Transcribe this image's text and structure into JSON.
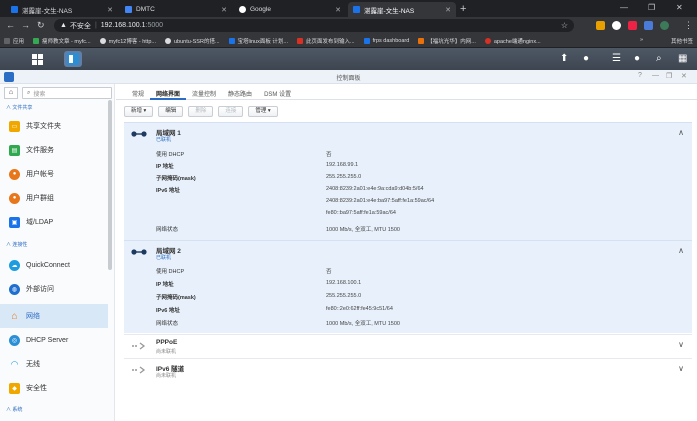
{
  "browser": {
    "tabs": [
      {
        "title": "湛露崖-文生-NAS",
        "color": "#1a73e8"
      },
      {
        "title": "DMTC",
        "color": "#4285f4"
      },
      {
        "title": "Google",
        "color": "#ffffff"
      },
      {
        "title": "湛露崖-文生-NAS",
        "color": "#1a73e8"
      }
    ],
    "new_tab": "+",
    "address": {
      "security": "不安全",
      "host": "192.168.100.1",
      "port": ":5000"
    },
    "bookmarks": [
      {
        "label": "应用",
        "color": "#5f6368"
      },
      {
        "label": "瘦师教文章 - myfc...",
        "color": "#34a853"
      },
      {
        "label": "myfc12博客 - http...",
        "color": "#dadce0"
      },
      {
        "label": "ubuntu-SSR的搭...",
        "color": "#dadce0"
      },
      {
        "label": "宝塔linux面板 计划...",
        "color": "#1a73e8"
      },
      {
        "label": "此页面发布到输入...",
        "color": "#d93025"
      },
      {
        "label": "frps dashboard",
        "color": "#1a73e8"
      },
      {
        "label": "【福坑光华】内网...",
        "color": "#e8710a"
      },
      {
        "label": "apache端通nginx...",
        "color": "#d93025"
      }
    ],
    "bookmarks_more": "»",
    "other_bookmarks": "其他书签"
  },
  "window": {
    "title": "控制面板"
  },
  "sidebar": {
    "search_placeholder": "搜索",
    "sections": {
      "file_sharing": "文件共享",
      "connectivity": "连接性",
      "system": "系统"
    },
    "items": [
      {
        "label": "共享文件夹",
        "color": "#f0a800",
        "icon": "folder-icon"
      },
      {
        "label": "文件服务",
        "color": "#2fa84f",
        "icon": "file-service-icon"
      },
      {
        "label": "用户帐号",
        "color": "#e8761a",
        "icon": "user-icon"
      },
      {
        "label": "用户群组",
        "color": "#e8761a",
        "icon": "group-icon"
      },
      {
        "label": "域/LDAP",
        "color": "#1a73e8",
        "icon": "domain-icon"
      },
      {
        "label": "QuickConnect",
        "color": "#1e9ce0",
        "icon": "cloud-icon"
      },
      {
        "label": "外部访问",
        "color": "#1e6fd0",
        "icon": "globe-icon"
      },
      {
        "label": "网络",
        "color": "#e8761a",
        "icon": "home-network-icon"
      },
      {
        "label": "DHCP Server",
        "color": "#2b8fd6",
        "icon": "dhcp-icon"
      },
      {
        "label": "无线",
        "color": "#1e9ce0",
        "icon": "wifi-icon"
      },
      {
        "label": "安全性",
        "color": "#f0a800",
        "icon": "shield-icon"
      }
    ]
  },
  "main": {
    "tabs": [
      "常规",
      "网络界面",
      "流量控制",
      "静态路由",
      "DSM 设置"
    ],
    "toolbar": {
      "new": "新增 ▾",
      "edit": "编辑",
      "delete": "删除",
      "connect": "连接",
      "manage": "管理 ▾"
    },
    "interfaces": [
      {
        "name": "局域网 1",
        "status": "已联机",
        "rows": [
          {
            "k": "使用 DHCP",
            "v": "否"
          },
          {
            "k": "IP 地址",
            "v": "192.168.99.1"
          },
          {
            "k": "子网掩码(mask)",
            "v": "255.255.255.0"
          },
          {
            "k": "IPv6 地址",
            "v": "2408:8239:2a01:e4e:9a:cda9:d04b:5/64"
          },
          {
            "k": "",
            "v": "2408:8239:2a01:e4e:ba97:5aff:fe1a:59ac/64"
          },
          {
            "k": "",
            "v": "fe80::ba97:5aff:fe1a:59ac/64"
          },
          {
            "k": "网络状态",
            "v": "1000 Mb/s, 全双工, MTU 1500"
          }
        ]
      },
      {
        "name": "局域网 2",
        "status": "已联机",
        "rows": [
          {
            "k": "使用 DHCP",
            "v": "否"
          },
          {
            "k": "IP 地址",
            "v": "192.168.100.1"
          },
          {
            "k": "子网掩码(mask)",
            "v": "255.255.255.0"
          },
          {
            "k": "IPv6 地址",
            "v": "fe80::2e0:62ff:fe45:9c51/64"
          },
          {
            "k": "网络状态",
            "v": "1000 Mb/s, 全双工, MTU 1500"
          }
        ]
      }
    ],
    "collapsed": [
      {
        "name": "PPPoE",
        "status": "尚未联机"
      },
      {
        "name": "IPv6 隧道",
        "status": "尚未联机"
      }
    ]
  }
}
